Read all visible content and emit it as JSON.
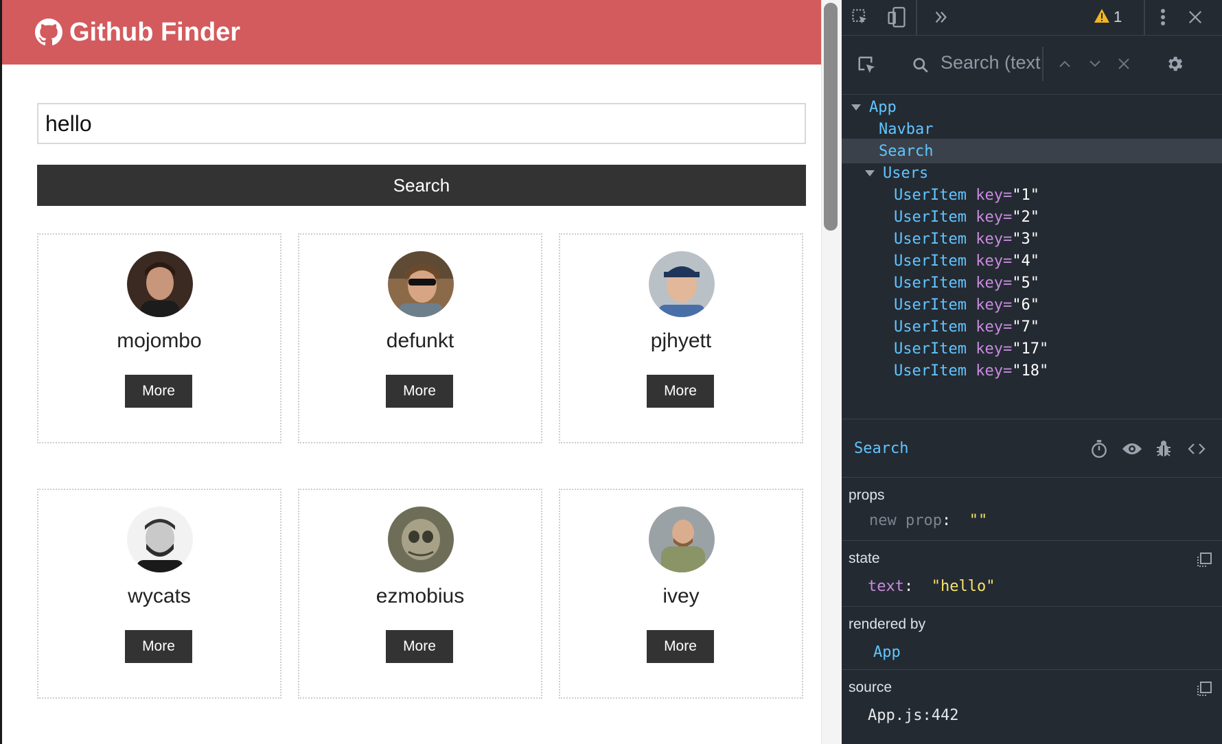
{
  "app": {
    "title": "Github Finder",
    "search": {
      "value": "hello",
      "placeholder": "",
      "button_label": "Search"
    },
    "users": [
      {
        "login": "mojombo",
        "button": "More"
      },
      {
        "login": "defunkt",
        "button": "More"
      },
      {
        "login": "pjhyett",
        "button": "More"
      },
      {
        "login": "wycats",
        "button": "More"
      },
      {
        "login": "ezmobius",
        "button": "More"
      },
      {
        "login": "ivey",
        "button": "More"
      }
    ]
  },
  "devtools": {
    "warning_count": "1",
    "search_placeholder": "Search (text",
    "tree": [
      {
        "component": "App",
        "key": "",
        "expanded": true
      },
      {
        "component": "Navbar",
        "key": ""
      },
      {
        "component": "Search",
        "key": "",
        "selected": true
      },
      {
        "component": "Users",
        "key": "",
        "expanded": true
      },
      {
        "component": "UserItem",
        "key": "1"
      },
      {
        "component": "UserItem",
        "key": "2"
      },
      {
        "component": "UserItem",
        "key": "3"
      },
      {
        "component": "UserItem",
        "key": "4"
      },
      {
        "component": "UserItem",
        "key": "5"
      },
      {
        "component": "UserItem",
        "key": "6"
      },
      {
        "component": "UserItem",
        "key": "7"
      },
      {
        "component": "UserItem",
        "key": "17"
      },
      {
        "component": "UserItem",
        "key": "18"
      }
    ],
    "inspected_component": "Search",
    "props": {
      "label": "props",
      "new_prop_key": "new prop",
      "new_prop_value": "\"\""
    },
    "state": {
      "label": "state",
      "key": "text",
      "value": "\"hello\""
    },
    "rendered_by": {
      "label": "rendered by",
      "value": "App"
    },
    "source": {
      "label": "source",
      "value": "App.js:442"
    },
    "colors": {
      "navbar": "#d35a5d",
      "dark_button": "#333333",
      "devtools_bg": "#242a32",
      "component_blue": "#61c5ff",
      "attr_purple": "#c98be0",
      "string_yellow": "#f5e36b"
    }
  }
}
